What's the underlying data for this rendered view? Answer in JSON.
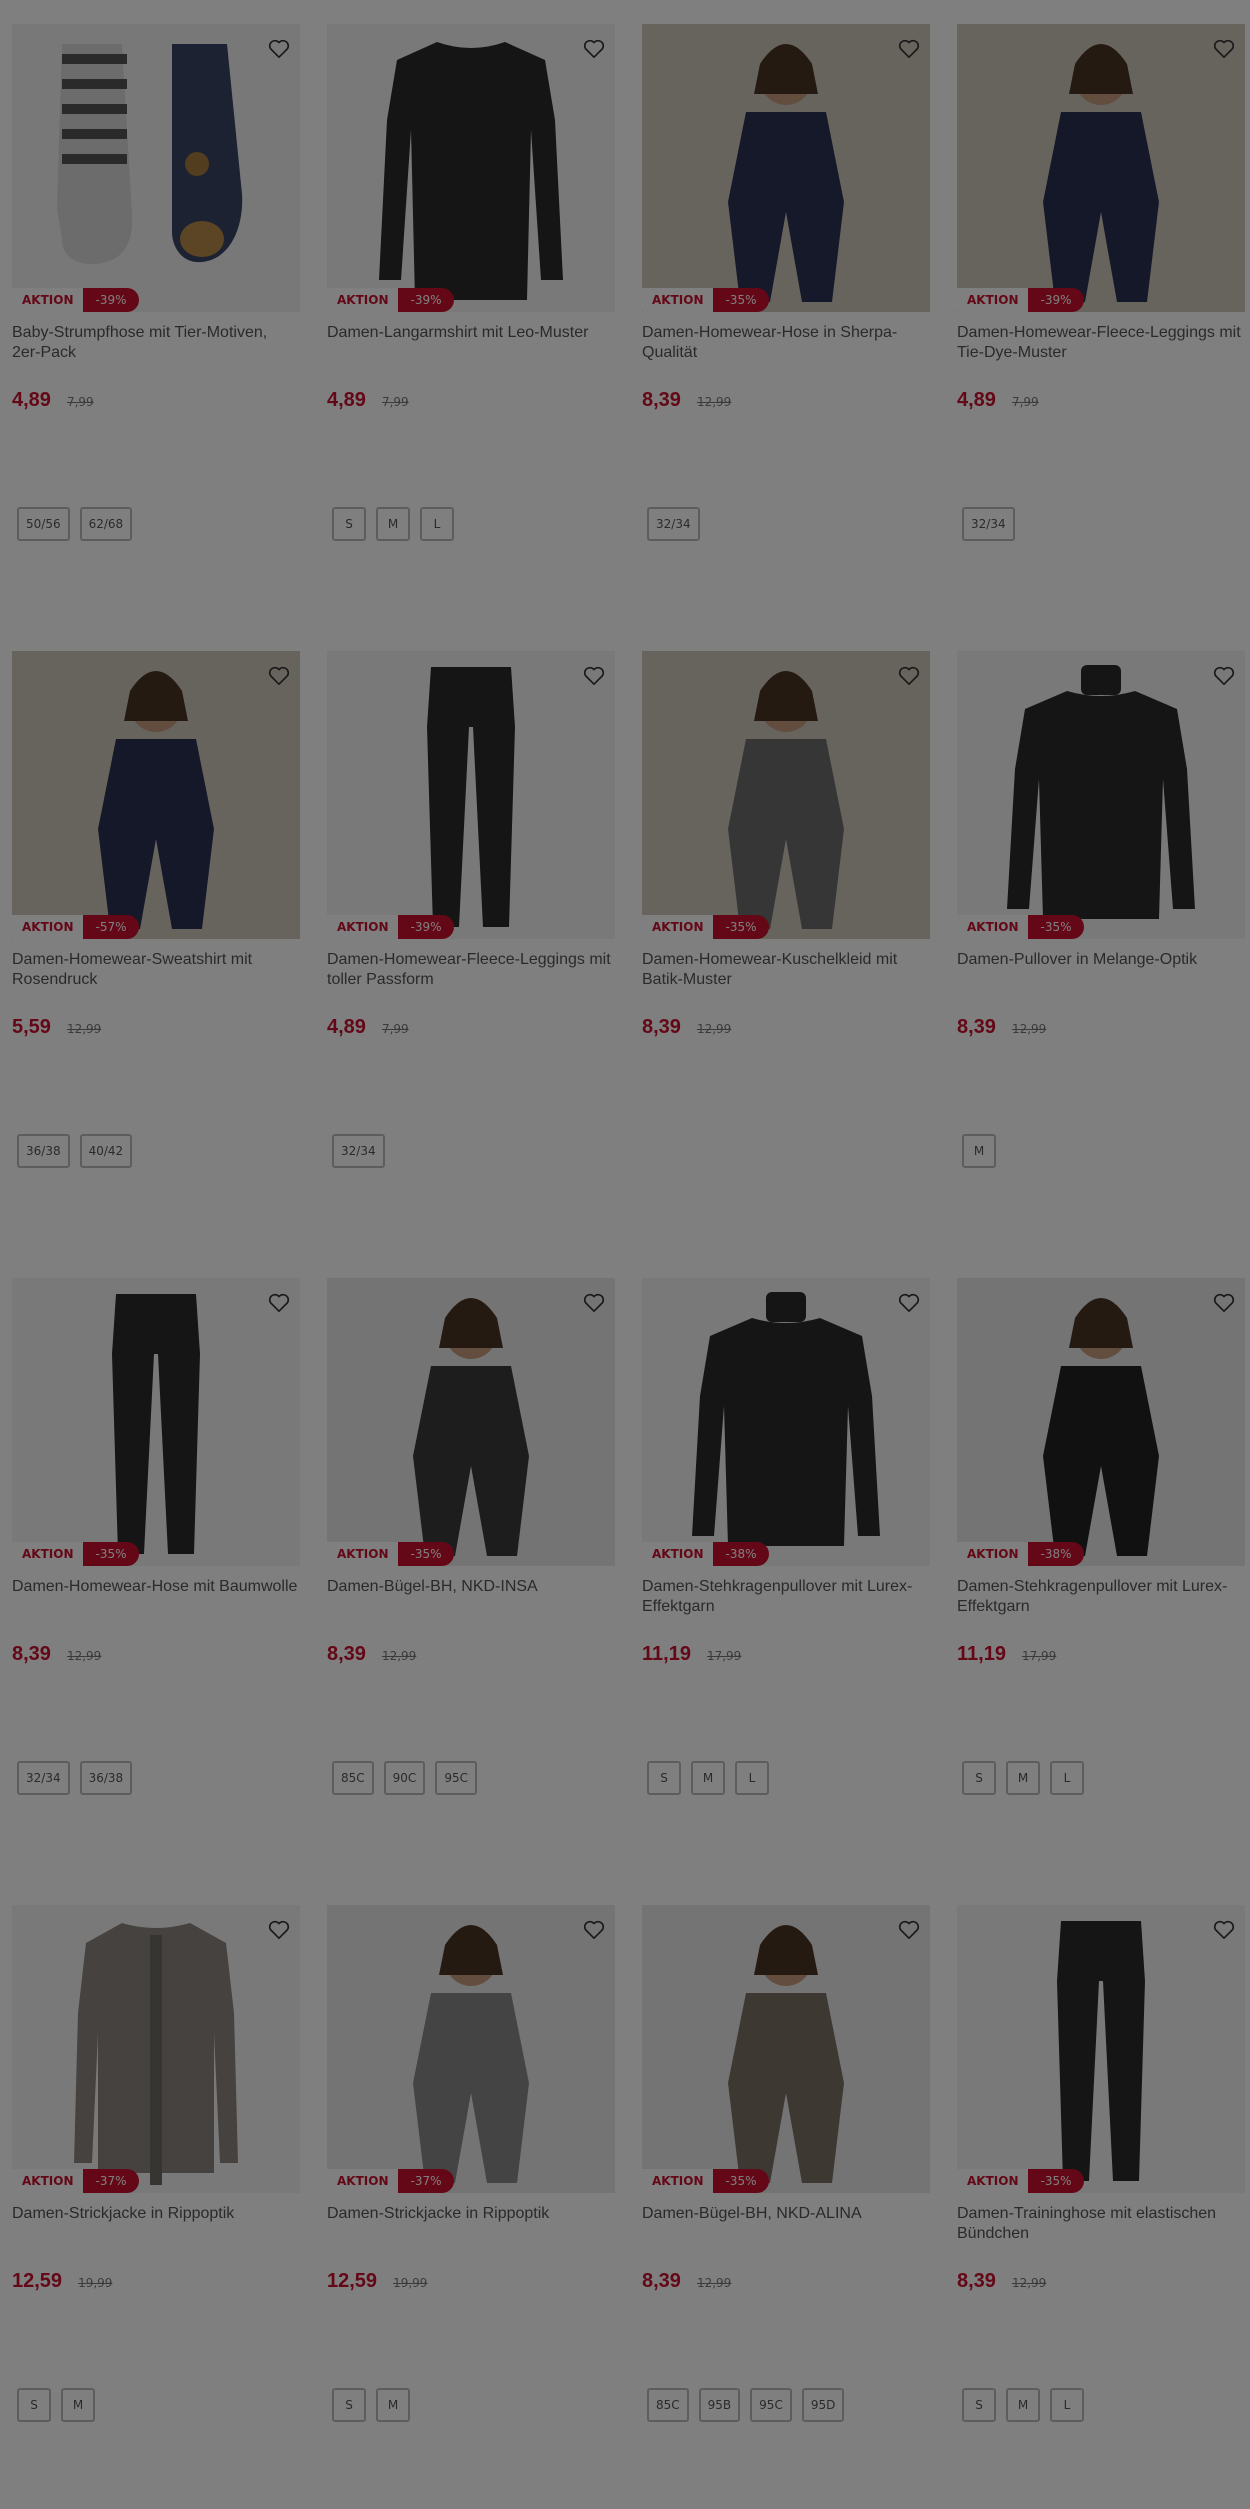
{
  "products": [
    {
      "title": "Baby-Strumpfhose mit Tier-Motiven, 2er-Pack",
      "price": "4,89",
      "old_price": "7,99",
      "badge": "AKTION",
      "discount": "-39%",
      "sizes": [
        "50/56",
        "62/68"
      ],
      "image": "tights"
    },
    {
      "title": "Damen-Langarmshirt mit Leo-Muster",
      "price": "4,89",
      "old_price": "7,99",
      "badge": "AKTION",
      "discount": "-39%",
      "sizes": [
        "S",
        "M",
        "L"
      ],
      "image": "longsleeve"
    },
    {
      "title": "Damen-Homewear-Hose in Sherpa-Qualität",
      "price": "8,39",
      "old_price": "12,99",
      "badge": "AKTION",
      "discount": "-35%",
      "sizes": [
        "32/34"
      ],
      "image": "model-navy"
    },
    {
      "title": "Damen-Homewear-Fleece-Leggings mit Tie-Dye-Muster",
      "price": "4,89",
      "old_price": "7,99",
      "badge": "AKTION",
      "discount": "-39%",
      "sizes": [
        "32/34"
      ],
      "image": "model-sofa"
    },
    {
      "title": "Damen-Homewear-Sweatshirt mit Rosendruck",
      "price": "5,59",
      "old_price": "12,99",
      "badge": "AKTION",
      "discount": "-57%",
      "sizes": [
        "36/38",
        "40/42"
      ],
      "image": "model-sofa2"
    },
    {
      "title": "Damen-Homewear-Fleece-Leggings mit toller Passform",
      "price": "4,89",
      "old_price": "7,99",
      "badge": "AKTION",
      "discount": "-39%",
      "sizes": [
        "32/34"
      ],
      "image": "leggings"
    },
    {
      "title": "Damen-Homewear-Kuschelkleid mit Batik-Muster",
      "price": "8,39",
      "old_price": "12,99",
      "badge": "AKTION",
      "discount": "-35%",
      "sizes": [],
      "image": "model-camo"
    },
    {
      "title": "Damen-Pullover in Melange-Optik",
      "price": "8,39",
      "old_price": "12,99",
      "badge": "AKTION",
      "discount": "-35%",
      "sizes": [
        "M"
      ],
      "image": "pullover"
    },
    {
      "title": "Damen-Homewear-Hose mit Baumwolle",
      "price": "8,39",
      "old_price": "12,99",
      "badge": "AKTION",
      "discount": "-35%",
      "sizes": [
        "32/34",
        "36/38"
      ],
      "image": "joggers"
    },
    {
      "title": "Damen-Bügel-BH, NKD-INSA",
      "price": "8,39",
      "old_price": "12,99",
      "badge": "AKTION",
      "discount": "-35%",
      "sizes": [
        "85C",
        "90C",
        "95C"
      ],
      "image": "model-bra"
    },
    {
      "title": "Damen-Stehkragenpullover mit Lurex-Effektgarn",
      "price": "11,19",
      "old_price": "17,99",
      "badge": "AKTION",
      "discount": "-38%",
      "sizes": [
        "S",
        "M",
        "L"
      ],
      "image": "turtleneck"
    },
    {
      "title": "Damen-Stehkragenpullover mit Lurex-Effektgarn",
      "price": "11,19",
      "old_price": "17,99",
      "badge": "AKTION",
      "discount": "-38%",
      "sizes": [
        "S",
        "M",
        "L"
      ],
      "image": "model-black"
    },
    {
      "title": "Damen-Strickjacke in Rippoptik",
      "price": "12,59",
      "old_price": "19,99",
      "badge": "AKTION",
      "discount": "-37%",
      "sizes": [
        "S",
        "M"
      ],
      "image": "cardigan"
    },
    {
      "title": "Damen-Strickjacke in Rippoptik",
      "price": "12,59",
      "old_price": "19,99",
      "badge": "AKTION",
      "discount": "-37%",
      "sizes": [
        "S",
        "M"
      ],
      "image": "model-cardigan"
    },
    {
      "title": "Damen-Bügel-BH, NKD-ALINA",
      "price": "8,39",
      "old_price": "12,99",
      "badge": "AKTION",
      "discount": "-35%",
      "sizes": [
        "85C",
        "95B",
        "95C",
        "95D"
      ],
      "image": "model-bra2"
    },
    {
      "title": "Damen-Traininghose mit elastischen Bündchen",
      "price": "8,39",
      "old_price": "12,99",
      "badge": "AKTION",
      "discount": "-35%",
      "sizes": [
        "S",
        "M",
        "L"
      ],
      "image": "trackpants"
    }
  ],
  "colors": {
    "accent": "#c8102e",
    "overlay": "rgba(0,0,0,0.5)"
  }
}
